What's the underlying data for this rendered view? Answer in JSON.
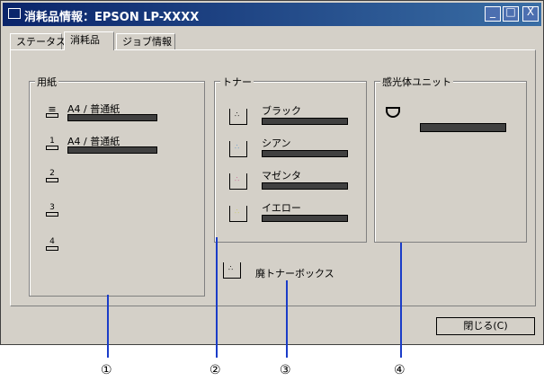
{
  "window": {
    "title": "消耗品情報：EPSON LP-XXXX"
  },
  "titlebar_buttons": {
    "minimize": "_",
    "maximize": "□",
    "close": "X"
  },
  "tabs": [
    {
      "label": "ステータス"
    },
    {
      "label": "消耗品"
    },
    {
      "label": "ジョブ情報"
    }
  ],
  "paper": {
    "label": "用紙",
    "trays": [
      {
        "icon": "paper-tray-mp-icon",
        "text": "A4 / 普通紙",
        "level": 1.0
      },
      {
        "icon": "paper-tray-1-icon",
        "number": "1",
        "text": "A4 / 普通紙",
        "level": 1.0
      },
      {
        "icon": "paper-tray-2-icon",
        "number": "2"
      },
      {
        "icon": "paper-tray-3-icon",
        "number": "3"
      },
      {
        "icon": "paper-tray-4-icon",
        "number": "4"
      }
    ]
  },
  "toner": {
    "label": "トナー",
    "items": [
      {
        "name": "ブラック",
        "level": 1.0,
        "color": "#000000"
      },
      {
        "name": "シアン",
        "level": 1.0,
        "color": "#6699cc"
      },
      {
        "name": "マゼンタ",
        "level": 1.0,
        "color": "#cc6699"
      },
      {
        "name": "イエロー",
        "level": 1.0,
        "color": "#cccc66"
      }
    ],
    "waste_label": "廃トナーボックス"
  },
  "photoconductor": {
    "label": "感光体ユニット",
    "level": 1.0
  },
  "close_button": {
    "label": "閉じる(C)"
  },
  "callouts": [
    "①",
    "②",
    "③",
    "④"
  ]
}
